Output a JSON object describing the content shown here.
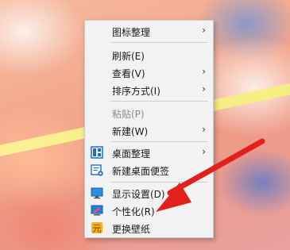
{
  "menu": {
    "items": [
      {
        "label": "图标整理",
        "submenu": true
      },
      {
        "label": "刷新(E)"
      },
      {
        "label": "查看(V)",
        "submenu": true
      },
      {
        "label": "排序方式(I)",
        "submenu": true
      },
      {
        "label": "粘贴(P)",
        "disabled": true
      },
      {
        "label": "新建(W)",
        "submenu": true
      },
      {
        "label": "桌面整理",
        "submenu": true,
        "icon": "desktop-organize-icon"
      },
      {
        "label": "新建桌面便签",
        "icon": "sticky-note-icon"
      },
      {
        "label": "显示设置(D)",
        "icon": "display-settings-icon"
      },
      {
        "label": "个性化(R)",
        "icon": "personalize-icon"
      },
      {
        "label": "更换壁纸",
        "icon": "wallpaper-icon"
      }
    ],
    "chevron": "›"
  },
  "colors": {
    "menu_bg": "#f2f2f2",
    "arrow": "#e3211c",
    "icon_blue": "#1f6fc5",
    "wallpaper_icon": "#f2b21b"
  }
}
